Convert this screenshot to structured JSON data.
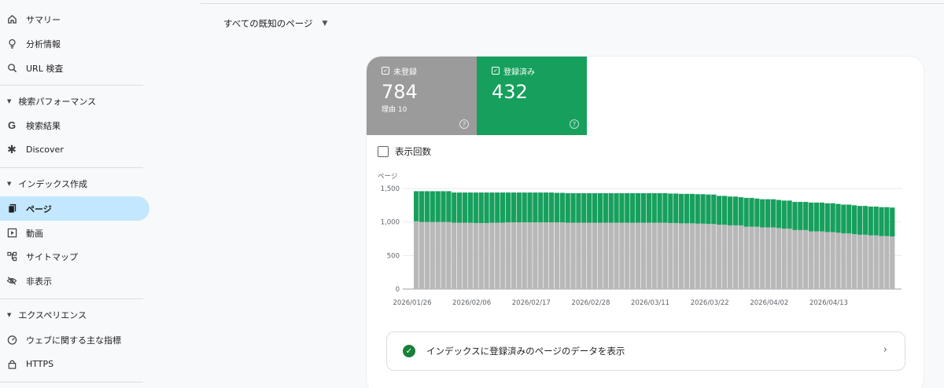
{
  "sidebar": {
    "items_top": [
      {
        "label": "サマリー",
        "icon": "home-icon"
      },
      {
        "label": "分析情報",
        "icon": "lightbulb-icon"
      },
      {
        "label": "URL 検査",
        "icon": "search-icon"
      }
    ],
    "sections": [
      {
        "title": "検索パフォーマンス",
        "items": [
          {
            "label": "検索結果",
            "icon": "google-g-icon"
          },
          {
            "label": "Discover",
            "icon": "asterisk-icon"
          }
        ]
      },
      {
        "title": "インデックス作成",
        "items": [
          {
            "label": "ページ",
            "icon": "pages-icon",
            "active": true
          },
          {
            "label": "動画",
            "icon": "video-icon"
          },
          {
            "label": "サイトマップ",
            "icon": "sitemap-icon"
          },
          {
            "label": "非表示",
            "icon": "eye-off-icon"
          }
        ]
      },
      {
        "title": "エクスペリエンス",
        "items": [
          {
            "label": "ウェブに関する主な指標",
            "icon": "gauge-icon"
          },
          {
            "label": "HTTPS",
            "icon": "lock-icon"
          }
        ]
      }
    ]
  },
  "filter": {
    "label": "すべての既知のページ"
  },
  "metrics": {
    "not_indexed": {
      "label": "未登録",
      "value": "784",
      "sub": "理由 10",
      "color": "#9b9b9b"
    },
    "indexed": {
      "label": "登録済み",
      "value": "432",
      "color": "#17a05d"
    }
  },
  "impressions": {
    "label": "表示回数"
  },
  "link": {
    "label": "インデックスに登録済みのページのデータを表示"
  },
  "chart_data": {
    "type": "bar",
    "stacked": true,
    "ylabel": "ページ",
    "ylim": [
      0,
      1500
    ],
    "yticks": [
      "0",
      "500",
      "1,000",
      "1,500"
    ],
    "xtick_labels": [
      "2026/01/26",
      "2026/02/06",
      "2026/02/17",
      "2026/02/28",
      "2026/03/11",
      "2026/03/22",
      "2026/04/02",
      "2026/04/13"
    ],
    "start_date": "2026-01-26",
    "grid": true,
    "series": [
      {
        "name": "未登録",
        "color": "#b8b8b8",
        "values": [
          1010,
          1000,
          1000,
          1000,
          1000,
          1000,
          1000,
          990,
          990,
          990,
          990,
          985,
          985,
          985,
          990,
          990,
          990,
          995,
          995,
          995,
          995,
          995,
          995,
          995,
          995,
          995,
          995,
          995,
          990,
          990,
          990,
          990,
          990,
          990,
          990,
          990,
          990,
          990,
          990,
          990,
          990,
          990,
          990,
          990,
          990,
          990,
          990,
          985,
          985,
          980,
          980,
          980,
          975,
          975,
          970,
          970,
          960,
          960,
          950,
          950,
          950,
          930,
          930,
          930,
          920,
          920,
          920,
          910,
          900,
          900,
          880,
          880,
          880,
          860,
          860,
          860,
          850,
          850,
          840,
          830,
          830,
          820,
          810,
          810,
          800,
          800,
          790,
          790,
          784
        ]
      },
      {
        "name": "登録済み",
        "color": "#17a05d",
        "values": [
          450,
          460,
          460,
          460,
          460,
          460,
          460,
          450,
          450,
          450,
          450,
          455,
          455,
          455,
          450,
          450,
          450,
          445,
          445,
          445,
          445,
          445,
          445,
          445,
          445,
          445,
          440,
          440,
          440,
          440,
          440,
          440,
          440,
          440,
          440,
          440,
          440,
          440,
          440,
          440,
          440,
          440,
          440,
          440,
          440,
          440,
          440,
          440,
          440,
          440,
          440,
          440,
          440,
          440,
          440,
          440,
          430,
          430,
          430,
          430,
          420,
          430,
          430,
          420,
          420,
          420,
          420,
          420,
          420,
          420,
          420,
          420,
          420,
          430,
          430,
          430,
          430,
          430,
          430,
          430,
          430,
          430,
          430,
          430,
          430,
          430,
          432,
          432,
          432
        ]
      }
    ]
  }
}
